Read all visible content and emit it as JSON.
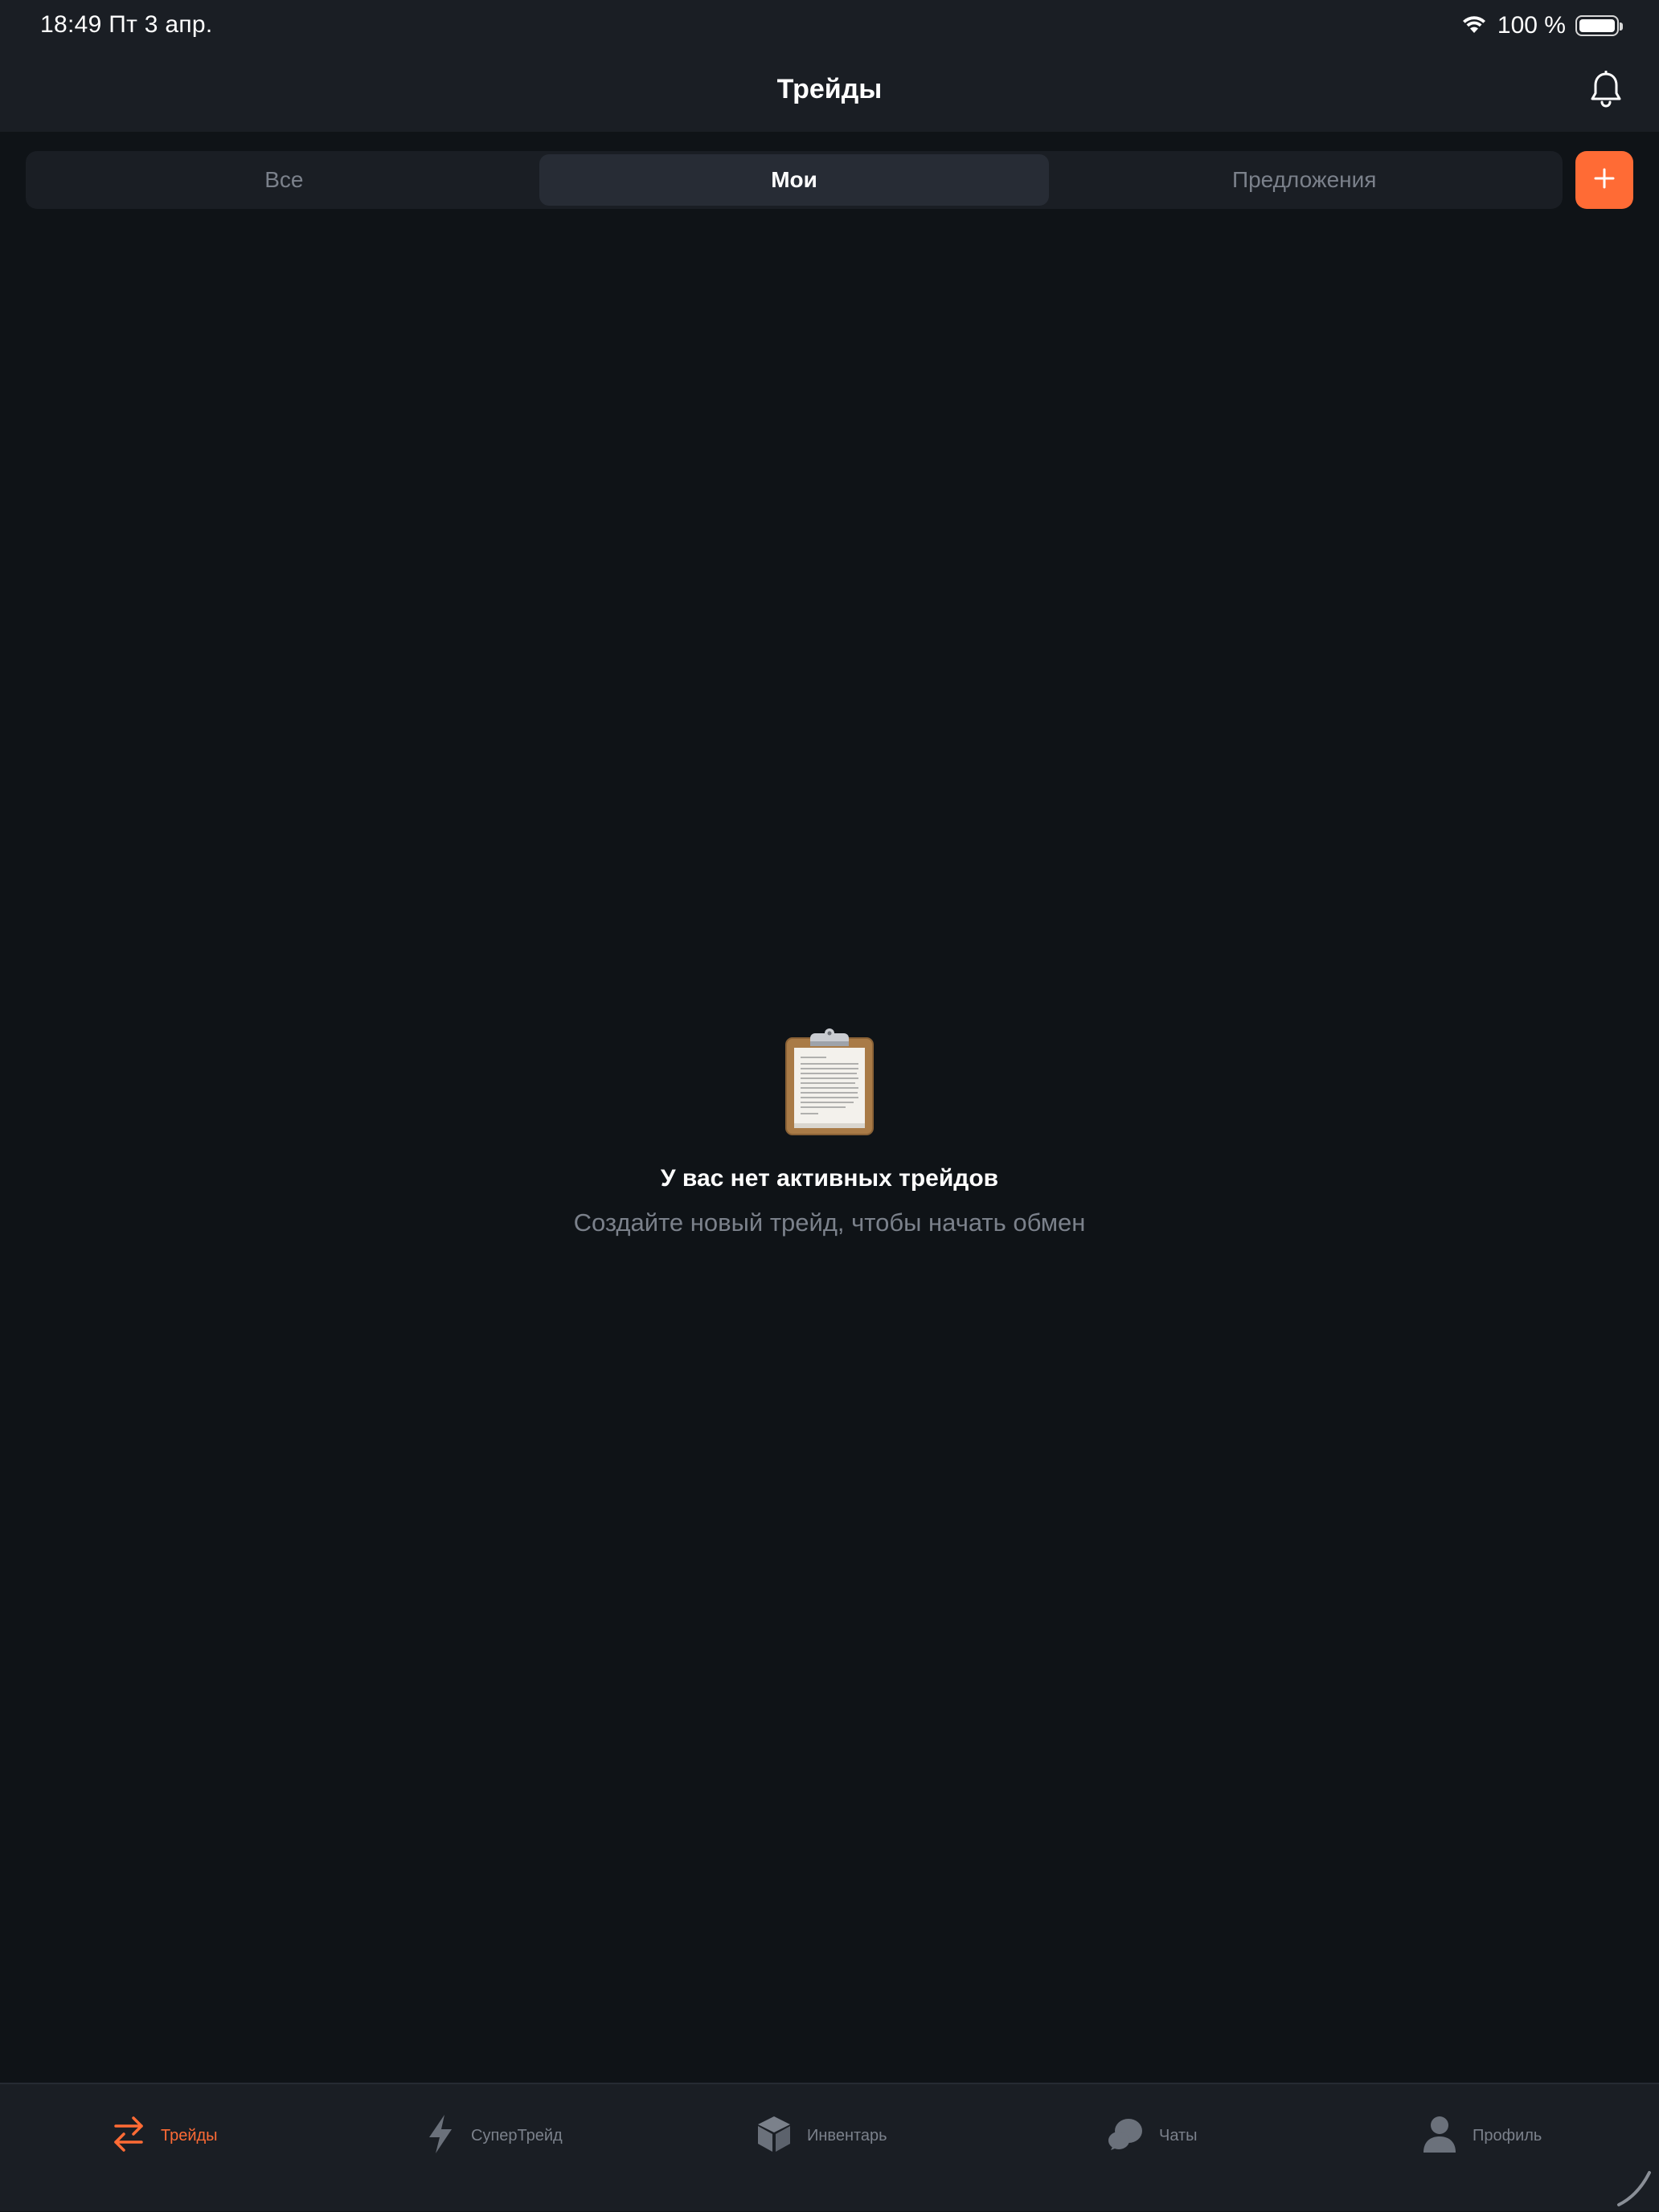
{
  "status_bar": {
    "time_date": "18:49  Пт 3 апр.",
    "battery": "100 %"
  },
  "nav": {
    "title": "Трейды",
    "bell_icon": "bell-icon"
  },
  "segments": {
    "tabs": [
      {
        "label": "Все",
        "active": false
      },
      {
        "label": "Мои",
        "active": true
      },
      {
        "label": "Предложения",
        "active": false
      }
    ],
    "add_icon": "plus-icon"
  },
  "empty_state": {
    "icon": "clipboard-icon",
    "title": "У вас нет активных трейдов",
    "subtitle": "Создайте новый трейд, чтобы начать обмен"
  },
  "tab_bar": {
    "items": [
      {
        "label": "Трейды",
        "icon": "arrows-swap-icon",
        "active": true
      },
      {
        "label": "СуперТрейд",
        "icon": "lightning-icon",
        "active": false
      },
      {
        "label": "Инвентарь",
        "icon": "cube-icon",
        "active": false
      },
      {
        "label": "Чаты",
        "icon": "chat-bubbles-icon",
        "active": false
      },
      {
        "label": "Профиль",
        "icon": "person-icon",
        "active": false
      }
    ]
  },
  "colors": {
    "accent": "#ff6b35",
    "background": "#0f1317",
    "surface": "#1a1e24",
    "muted_text": "#7b818b"
  }
}
